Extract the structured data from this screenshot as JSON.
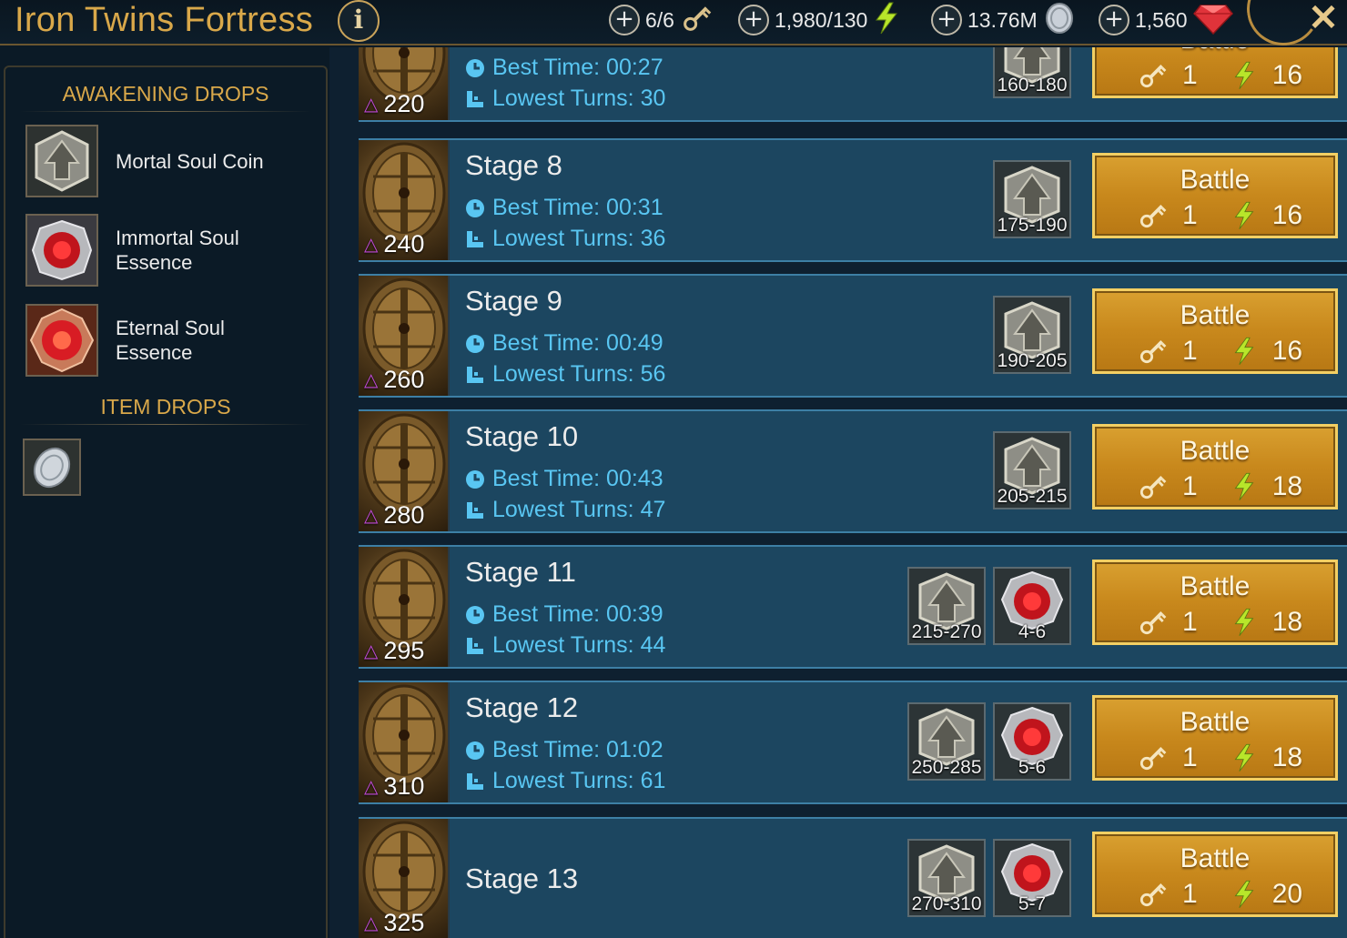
{
  "header": {
    "title": "Iron Twins Fortress",
    "info_label": "i",
    "close_label": "✕",
    "resources": [
      {
        "id": "keys",
        "value": "6/6",
        "icon": "key-icon"
      },
      {
        "id": "energy",
        "value": "1,980/130",
        "icon": "energy-bolt-icon"
      },
      {
        "id": "silver",
        "value": "13.76M",
        "icon": "silver-coin-icon"
      },
      {
        "id": "gems",
        "value": "1,560",
        "icon": "ruby-gem-icon"
      }
    ]
  },
  "sidebar": {
    "awakening_title": "AWAKENING DROPS",
    "awakening_items": [
      {
        "label": "Mortal Soul Coin",
        "icon": "mortal-soul-coin-icon"
      },
      {
        "label": "Immortal Soul Essence",
        "icon": "immortal-soul-essence-icon"
      },
      {
        "label": "Eternal Soul Essence",
        "icon": "eternal-soul-essence-icon"
      }
    ],
    "item_title": "ITEM DROPS",
    "item_icon": "silver-coin-icon"
  },
  "stages": [
    {
      "name": "",
      "power": "220",
      "best_time": "Best Time: 00:27",
      "lowest_turns": "Lowest Turns: 30",
      "rewards": [
        "160-180"
      ],
      "key_cost": "1",
      "energy_cost": "16",
      "battle": "Battle"
    },
    {
      "name": "Stage 8",
      "power": "240",
      "best_time": "Best Time: 00:31",
      "lowest_turns": "Lowest Turns: 36",
      "rewards": [
        "175-190"
      ],
      "key_cost": "1",
      "energy_cost": "16",
      "battle": "Battle"
    },
    {
      "name": "Stage 9",
      "power": "260",
      "best_time": "Best Time: 00:49",
      "lowest_turns": "Lowest Turns: 56",
      "rewards": [
        "190-205"
      ],
      "key_cost": "1",
      "energy_cost": "16",
      "battle": "Battle"
    },
    {
      "name": "Stage 10",
      "power": "280",
      "best_time": "Best Time: 00:43",
      "lowest_turns": "Lowest Turns: 47",
      "rewards": [
        "205-215"
      ],
      "key_cost": "1",
      "energy_cost": "18",
      "battle": "Battle"
    },
    {
      "name": "Stage 11",
      "power": "295",
      "best_time": "Best Time: 00:39",
      "lowest_turns": "Lowest Turns: 44",
      "rewards": [
        "215-270",
        "4-6"
      ],
      "key_cost": "1",
      "energy_cost": "18",
      "battle": "Battle"
    },
    {
      "name": "Stage 12",
      "power": "310",
      "best_time": "Best Time: 01:02",
      "lowest_turns": "Lowest Turns: 61",
      "rewards": [
        "250-285",
        "5-6"
      ],
      "key_cost": "1",
      "energy_cost": "18",
      "battle": "Battle"
    },
    {
      "name": "Stage 13",
      "power": "325",
      "best_time": "",
      "lowest_turns": "",
      "rewards": [
        "270-310",
        "5-7"
      ],
      "key_cost": "1",
      "energy_cost": "20",
      "battle": "Battle"
    }
  ],
  "colors": {
    "gold": "#d9a84a",
    "stat_blue": "#59c6f2",
    "row_bg": "#1c4660",
    "battle_bg": "#c8881c"
  }
}
